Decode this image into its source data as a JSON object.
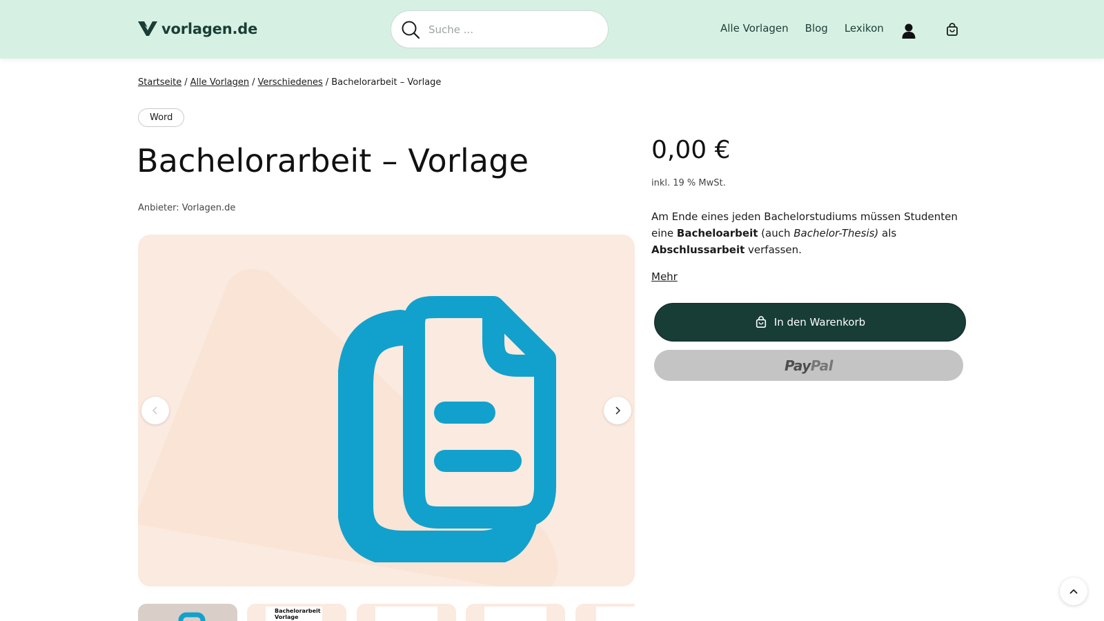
{
  "header": {
    "logo_text": "vorlagen.de",
    "search_placeholder": "Suche ...",
    "nav": [
      {
        "label": "Alle Vorlagen"
      },
      {
        "label": "Blog"
      },
      {
        "label": "Lexikon"
      }
    ],
    "icons": {
      "search": "search-icon",
      "user": "user-icon",
      "cart": "shopping-bag-icon"
    }
  },
  "breadcrumb": [
    {
      "label": "Startseite"
    },
    {
      "label": "Alle Vorlagen"
    },
    {
      "label": "Verschiedenes"
    },
    {
      "label": "Bachelorarbeit – Vorlage"
    }
  ],
  "product": {
    "format_badge": "Word",
    "title": "Bachelorarbeit – Vorlage",
    "vendor": "Anbieter: Vorlagen.de",
    "price": "0,00 €",
    "tax_note": "inkl. 19 % MwSt.",
    "description": {
      "part1": "Am Ende eines jeden Bachelorstudiums müssen Studenten eine ",
      "bold1": "Bacheloarbeit",
      "part2": " (auch ",
      "italic1": "Bachelor-Thesis)",
      "part3": " als ",
      "bold2": "Abschlussarbeit",
      "part4": " verfassen."
    },
    "more_link": "Mehr",
    "add_to_cart": "In den Warenkorb",
    "paypal_label_a": "Pay",
    "paypal_label_b": "Pal"
  },
  "gallery": {
    "thumb2_title": "Bachelorarbeit\nVorlage"
  },
  "colors": {
    "header_bg": "#d6f1e3",
    "brand_dark": "#173d36",
    "image_bg": "#fbeae0",
    "doc_icon": "#12a1cc",
    "paypal_btn": "#c4c4c4"
  }
}
